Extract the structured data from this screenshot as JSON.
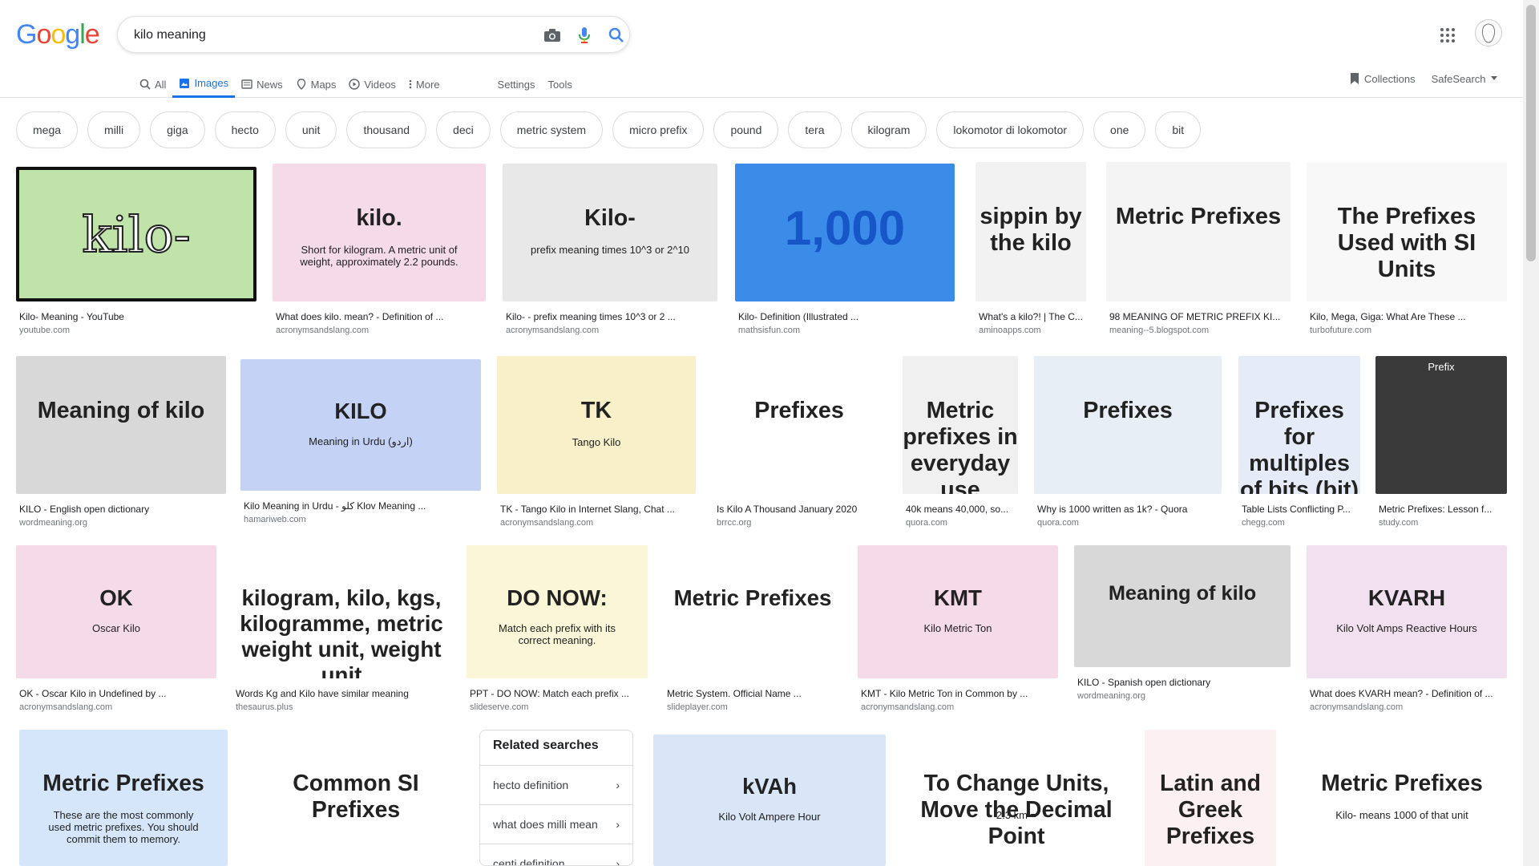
{
  "logo": "Google",
  "colors": {
    "blue": "#4285F4",
    "red": "#EA4335",
    "yellow": "#FBBC05",
    "green": "#34A853",
    "accent": "#1a73e8"
  },
  "search": {
    "query": "kilo meaning",
    "icons": [
      "camera-icon",
      "mic-icon",
      "search-icon"
    ]
  },
  "tabs": [
    {
      "label": "All",
      "icon": "search-icon"
    },
    {
      "label": "Images",
      "icon": "image-icon",
      "active": true
    },
    {
      "label": "News",
      "icon": "news-icon"
    },
    {
      "label": "Maps",
      "icon": "map-pin-icon"
    },
    {
      "label": "Videos",
      "icon": "play-icon"
    },
    {
      "label": "More",
      "icon": "more-vertical-icon"
    },
    {
      "label": "Settings"
    },
    {
      "label": "Tools"
    }
  ],
  "right_links": {
    "collections": "Collections",
    "safesearch": "SafeSearch"
  },
  "chips": [
    "mega",
    "milli",
    "giga",
    "hecto",
    "unit",
    "thousand",
    "deci",
    "metric system",
    "micro prefix",
    "pound",
    "tera",
    "kilogram",
    "lokomotor di lokomotor",
    "one",
    "bit"
  ],
  "results": [
    {
      "caption": "Kilo- Meaning - YouTube",
      "source": "youtube.com",
      "thumb": "kilo-",
      "bg": "#bfe3a9"
    },
    {
      "caption": "What does kilo. mean? - Definition of ...",
      "source": "acronymsandslang.com",
      "thumb": "kilo.",
      "sub": "Short for kilogram. A metric unit of weight, approximately 2.2 pounds.",
      "bg": "#f5dbe8"
    },
    {
      "caption": "Kilo- - prefix meaning times 10^3 or 2 ...",
      "source": "acronymsandslang.com",
      "thumb": "Kilo-",
      "sub": "prefix meaning times 10^3 or 2^10",
      "bg": "#e8e8e8"
    },
    {
      "caption": "Kilo- Definition (Illustrated ...",
      "source": "mathsisfun.com",
      "thumb": "1,000",
      "bg": "#3b8be8"
    },
    {
      "caption": "What's a kilo?! | The C...",
      "source": "aminoapps.com",
      "thumb": "sippin by the kilo",
      "bg": "#f2f2f2"
    },
    {
      "caption": "98 MEANING OF METRIC PREFIX KI...",
      "source": "meaning--5.blogspot.com",
      "thumb": "Metric Prefixes",
      "bg": "#f4f4f4"
    },
    {
      "caption": "Kilo, Mega, Giga: What Are These ...",
      "source": "turbofuture.com",
      "thumb": "The Prefixes Used with SI Units",
      "bg": "#f8f8f8"
    },
    {
      "caption": "KILO - English open dictionary",
      "source": "wordmeaning.org",
      "thumb": "Meaning of kilo",
      "bg": "#d8d8d8"
    },
    {
      "caption": "Kilo Meaning in Urdu - کلو Klov Meaning ...",
      "source": "hamariweb.com",
      "thumb": "KILO",
      "sub": "Meaning in Urdu (اردو)",
      "bg": "#c4d2f5"
    },
    {
      "caption": "TK - Tango Kilo in Internet Slang, Chat ...",
      "source": "acronymsandslang.com",
      "thumb": "TK",
      "sub": "Tango Kilo",
      "bg": "#f7f0c8"
    },
    {
      "caption": "Is Kilo A Thousand January 2020",
      "source": "brrcc.org",
      "thumb": "Prefixes",
      "bg": "#ffffff"
    },
    {
      "caption": "40k means 40,000, so...",
      "source": "quora.com",
      "thumb": "Metric prefixes in everyday use",
      "bg": "#f0f0f0"
    },
    {
      "caption": "Why is 1000 written as 1k? - Quora",
      "source": "quora.com",
      "thumb": "Prefixes",
      "bg": "#e8eef5"
    },
    {
      "caption": "Table Lists Conflicting P...",
      "source": "chegg.com",
      "thumb": "Prefixes for multiples of bits (bit) or bytes (B)",
      "bg": "#e6ecf7"
    },
    {
      "caption": "Metric Prefixes: Lesson f...",
      "source": "study.com",
      "thumb": "Prefix",
      "bg": "#3a3a3a"
    },
    {
      "caption": "OK - Oscar Kilo in Undefined by ...",
      "source": "acronymsandslang.com",
      "thumb": "OK",
      "sub": "Oscar Kilo",
      "bg": "#f5dbe8"
    },
    {
      "caption": "Words Kg and Kilo have similar meaning",
      "source": "thesaurus.plus",
      "thumb": "kilogram, kilo, kgs, kilogramme, metric weight unit, weight unit",
      "bg": "#ffffff"
    },
    {
      "caption": "PPT - DO NOW: Match each prefix ...",
      "source": "slideserve.com",
      "thumb": "DO NOW:",
      "sub": "Match each prefix with its correct meaning.",
      "bg": "#fbf6d8"
    },
    {
      "caption": "Metric System. Official Name ...",
      "source": "slideplayer.com",
      "thumb": "Metric Prefixes",
      "bg": "#ffffff"
    },
    {
      "caption": "KMT - Kilo Metric Ton in Common by ...",
      "source": "acronymsandslang.com",
      "thumb": "KMT",
      "sub": "Kilo Metric Ton",
      "bg": "#f5dbe8"
    },
    {
      "caption": "KILO - Spanish open dictionary",
      "source": "wordmeaning.org",
      "thumb": "Meaning of kilo",
      "bg": "#d8d8d8"
    },
    {
      "caption": "What does KVARH mean? - Definition of ...",
      "source": "acronymsandslang.com",
      "thumb": "KVARH",
      "sub": "Kilo Volt Amps Reactive Hours",
      "bg": "#f0e0f0"
    },
    {
      "thumb": "Metric Prefixes",
      "sub": "These are the most commonly used metric prefixes. You should commit them to memory.",
      "bg": "#d6e6fa"
    },
    {
      "thumb": "Common SI Prefixes",
      "bg": "#ffffff"
    },
    {
      "thumb": "kVAh",
      "sub": "Kilo Volt Ampere Hour",
      "bg": "#d8e6f7"
    },
    {
      "thumb": "To Change Units, Move the Decimal Point",
      "sub": "2.3 km =",
      "bg": "#ffffff"
    },
    {
      "thumb": "Latin and Greek Prefixes",
      "bg": "#fdf0f3"
    },
    {
      "thumb": "Metric Prefixes",
      "sub": "Kilo- means 1000 of that unit",
      "bg": "#ffffff"
    }
  ],
  "related": {
    "title": "Related searches",
    "items": [
      "hecto definition",
      "what does milli mean",
      "centi definition"
    ]
  }
}
